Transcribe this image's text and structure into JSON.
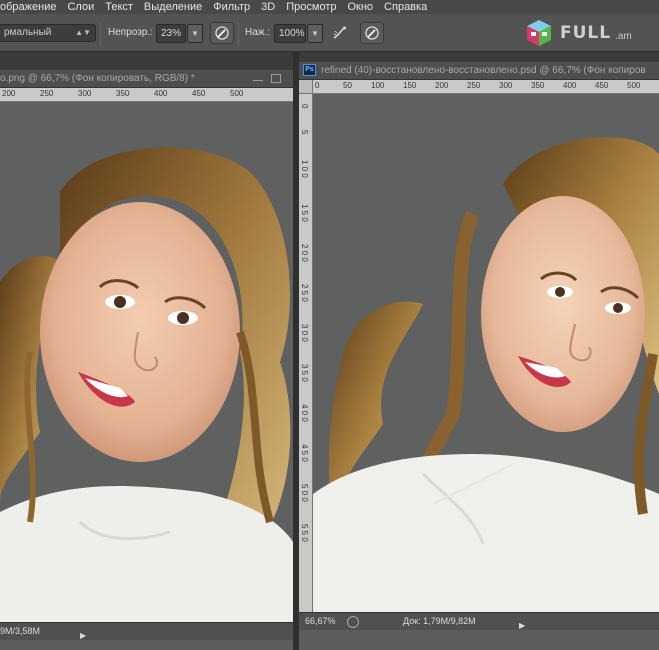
{
  "menu": [
    "ображение",
    "Слои",
    "Текст",
    "Выделение",
    "Фильтр",
    "3D",
    "Просмотр",
    "Окно",
    "Справка"
  ],
  "options": {
    "blend_mode": "рмальный",
    "opacity_label": "Непрозр.:",
    "opacity_value": "23%",
    "pressure_label": "Наж.:",
    "pressure_value": "100%"
  },
  "watermark": {
    "text": "FULL",
    "suffix": ".am"
  },
  "left_doc": {
    "tab_title": "о.png @ 66,7% (Фон копировать, RGB/8) *",
    "status_doc": "9M/3,58M",
    "ruler_ticks": [
      "200",
      "250",
      "300",
      "350",
      "400",
      "450",
      "500"
    ]
  },
  "right_doc": {
    "tab_title": "refined (40)-восстановлено-восстановлено.psd @ 66,7% (Фон копиров",
    "zoom": "66,67%",
    "status_doc": "Док: 1,79M/9,82M",
    "ruler_ticks": [
      "0",
      "50",
      "100",
      "150",
      "200",
      "250",
      "300",
      "350",
      "400",
      "450",
      "500"
    ],
    "vruler_ticks": [
      "0",
      "5",
      "1 0 0",
      "1 5 0",
      "2 0 0",
      "2 5 0",
      "3 0 0",
      "3 5 0",
      "4 0 0",
      "4 5 0",
      "5 0 0",
      "5 5 0"
    ]
  },
  "colors": {
    "ps_bg": "#535353",
    "canvas_bg": "#5f6060",
    "ruler": "#c9c9c9",
    "ps_blue": "#4d8fd6"
  }
}
